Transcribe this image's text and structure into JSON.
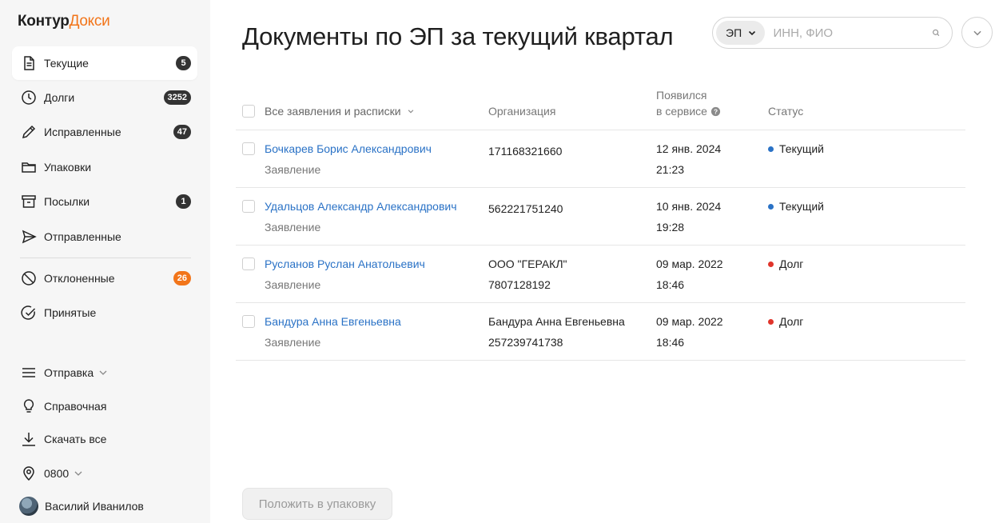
{
  "logo": {
    "part1": "Контур",
    "part2": "Докси"
  },
  "sidebar": {
    "items": [
      {
        "label": "Текущие",
        "badge": "5",
        "icon": "document-icon",
        "active": true
      },
      {
        "label": "Долги",
        "badge": "3252",
        "icon": "clock-icon"
      },
      {
        "label": "Исправленные",
        "badge": "47",
        "icon": "pencil-icon"
      },
      {
        "label": "Упаковки",
        "badge": "",
        "icon": "folder-icon"
      },
      {
        "label": "Посылки",
        "badge": "1",
        "icon": "archive-box-icon"
      },
      {
        "label": "Отправленные",
        "badge": "",
        "icon": "send-icon"
      },
      {
        "label": "Отклоненные",
        "badge": "26",
        "icon": "block-icon",
        "badge_color": "#f2751a"
      },
      {
        "label": "Принятые",
        "badge": "",
        "icon": "check-circle-icon"
      }
    ],
    "bottom": [
      {
        "label": "Отправка",
        "icon": "menu-icon",
        "chevron": true
      },
      {
        "label": "Справочная",
        "icon": "lightbulb-icon"
      },
      {
        "label": "Скачать все",
        "icon": "download-icon"
      },
      {
        "label": "0800",
        "icon": "location-pin-icon",
        "chevron": true
      },
      {
        "label": "Василий Иванилов",
        "icon": "avatar"
      }
    ]
  },
  "page": {
    "title": "Документы по ЭП за текущий квартал"
  },
  "search": {
    "filter_value": "ЭП",
    "placeholder": "ИНН, ФИО"
  },
  "table": {
    "headers": {
      "type_filter": "Все заявления и расписки",
      "organization": "Организация",
      "appeared_line1": "Появился",
      "appeared_line2": "в сервисе",
      "status": "Статус"
    },
    "rows": [
      {
        "name": "Бочкарев Борис Александрович",
        "kind": "Заявление",
        "org1": "171168321660",
        "org2": "",
        "date": "12 янв. 2024",
        "time": "21:23",
        "status": "Текущий",
        "status_color": "#2a72c6"
      },
      {
        "name": "Удальцов Александр Александрович",
        "kind": "Заявление",
        "org1": "562221751240",
        "org2": "",
        "date": "10 янв. 2024",
        "time": "19:28",
        "status": "Текущий",
        "status_color": "#2a72c6"
      },
      {
        "name": "Русланов Руслан Анатольевич",
        "kind": "Заявление",
        "org1": "ООО \"ГЕРАКЛ\"",
        "org2": "7807128192",
        "date": "09 мар. 2022",
        "time": "18:46",
        "status": "Долг",
        "status_color": "#e0342b"
      },
      {
        "name": "Бандура Анна Евгеньевна",
        "kind": "Заявление",
        "org1": "Бандура Анна Евгеньевна",
        "org2": "257239741738",
        "date": "09 мар. 2022",
        "time": "18:46",
        "status": "Долг",
        "status_color": "#e0342b"
      }
    ]
  },
  "actions": {
    "pack_label": "Положить в упаковку"
  },
  "colors": {
    "accent": "#f2751a",
    "link": "#2a72c6",
    "debt": "#e0342b"
  }
}
